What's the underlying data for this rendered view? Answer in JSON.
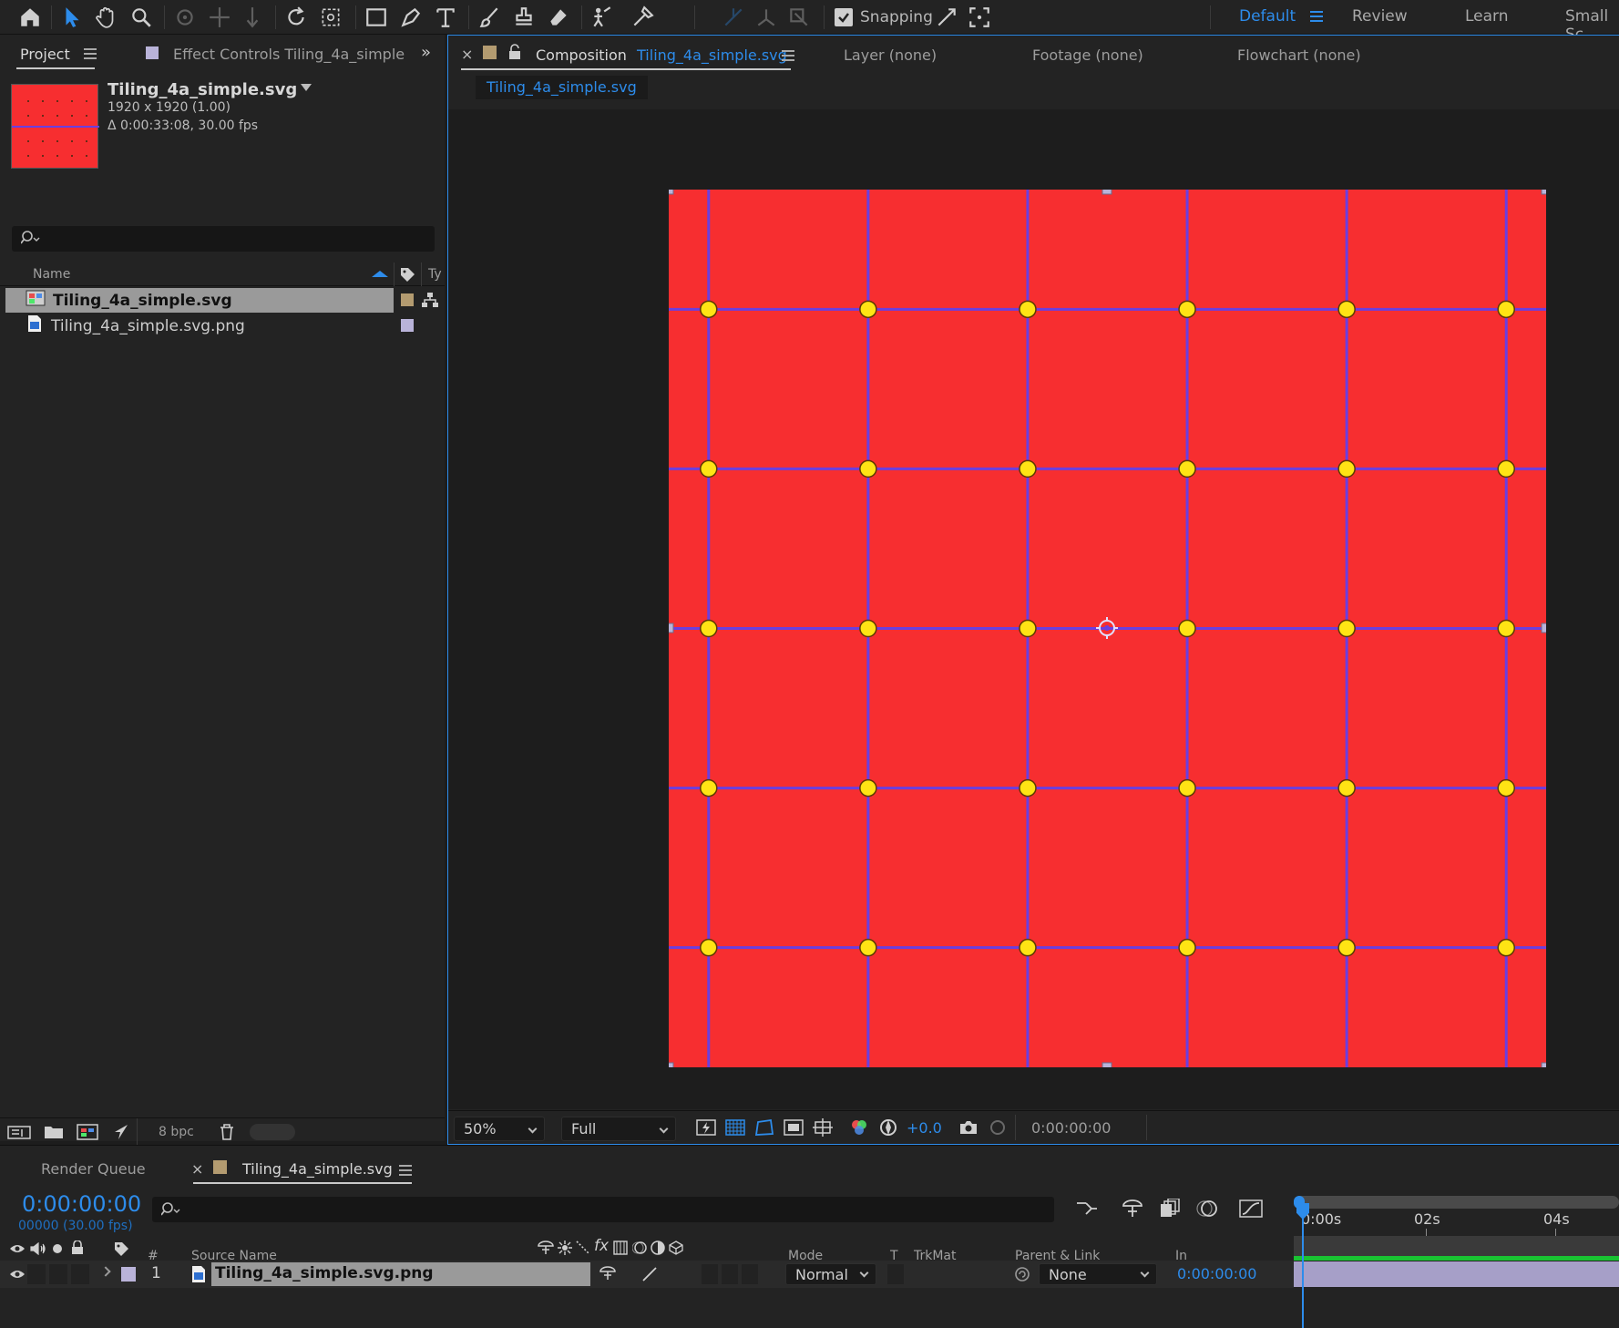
{
  "toolbar": {
    "tools": [
      "home-icon",
      "selection-icon",
      "hand-icon",
      "zoom-icon",
      "orbit-camera-icon",
      "pan-camera-icon",
      "dolly-camera-icon",
      "rotate-icon",
      "pan-behind-icon",
      "rectangle-icon",
      "pen-icon",
      "text-icon",
      "brush-icon",
      "clone-stamp-icon",
      "eraser-icon",
      "roto-brush-icon",
      "puppet-pin-icon"
    ],
    "snapping_label": "Snapping",
    "snapping_checked": true,
    "workspaces": [
      "Default",
      "Review",
      "Learn",
      "Small Sc"
    ],
    "active_workspace": "Default"
  },
  "project": {
    "tab_label": "Project",
    "effect_controls_label": "Effect Controls",
    "effect_controls_target": "Tiling_4a_simple",
    "item_name": "Tiling_4a_simple.svg",
    "item_size": "1920 x 1920 (1.00)",
    "item_duration": "Δ 0:00:33:08, 30.00 fps",
    "column_name": "Name",
    "column_type": "Ty",
    "items": [
      {
        "name": "Tiling_4a_simple.svg",
        "selected": true
      },
      {
        "name": "Tiling_4a_simple.svg.png",
        "selected": false
      }
    ],
    "bpc_label": "8 bpc"
  },
  "comp_viewer": {
    "composition_prefix": "Composition",
    "composition_name": "Tiling_4a_simple.svg",
    "layer_tab": "Layer",
    "layer_value": "(none)",
    "footage_tab": "Footage",
    "footage_value": "(none)",
    "flowchart_tab": "Flowchart",
    "flowchart_value": "(none)",
    "breadcrumb": "Tiling_4a_simple.svg",
    "zoom": "50%",
    "resolution": "Full",
    "exposure": "+0.0",
    "timecode": "0:00:00:00",
    "colors": {
      "background": "#f72e30",
      "lines": "#6a3fe0",
      "dots": "#ffe414",
      "dot_outline": "#5c3a00"
    },
    "grid": {
      "columns": 6,
      "rows": 5
    }
  },
  "timeline": {
    "render_queue_label": "Render Queue",
    "comp_tab_label": "Tiling_4a_simple.svg",
    "current_time": "0:00:00:00",
    "frame_info": "00000 (30.00 fps)",
    "columns": {
      "index": "#",
      "source_name": "Source Name",
      "mode": "Mode",
      "t": "T",
      "trkmat": "TrkMat",
      "parent": "Parent & Link",
      "in": "In"
    },
    "layer": {
      "index": "1",
      "name": "Tiling_4a_simple.svg.png",
      "mode": "Normal",
      "parent": "None",
      "in_time": "0:00:00:00"
    },
    "ruler": [
      "0:00s",
      "02s",
      "04s"
    ]
  }
}
